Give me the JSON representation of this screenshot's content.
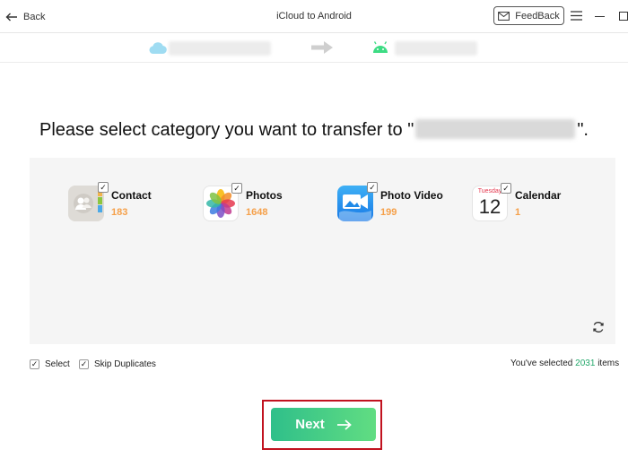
{
  "header": {
    "back_label": "Back",
    "title": "iCloud to Android",
    "feedback_label": "FeedBack"
  },
  "transfer": {
    "heading_prefix": "Please select category you want to transfer to \"",
    "heading_suffix": "\"."
  },
  "categories": [
    {
      "name": "Contact",
      "count": "183",
      "checked": true,
      "icon": "contacts-icon"
    },
    {
      "name": "Photos",
      "count": "1648",
      "checked": true,
      "icon": "photos-icon"
    },
    {
      "name": "Photo Video",
      "count": "199",
      "checked": true,
      "icon": "photo-video-icon"
    },
    {
      "name": "Calendar",
      "count": "1",
      "checked": true,
      "icon": "calendar-icon",
      "calendar_day": "Tuesday",
      "calendar_date": "12"
    }
  ],
  "options": {
    "select_label": "Select",
    "skip_duplicates_label": "Skip Duplicates"
  },
  "summary": {
    "prefix": "You've selected",
    "count": "2031",
    "suffix": "items"
  },
  "next": {
    "label": "Next"
  },
  "colors": {
    "accent_green": "#2fbf8a",
    "count_orange": "#f5a04a",
    "highlight_red": "#c1121f"
  }
}
